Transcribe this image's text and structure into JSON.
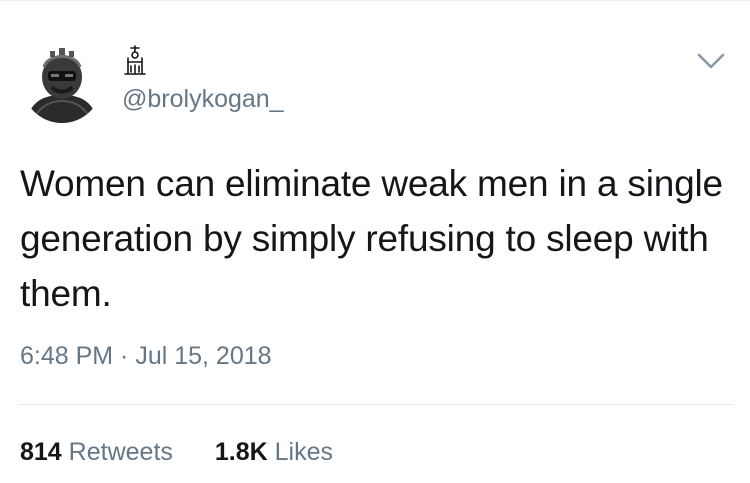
{
  "tweet": {
    "handle": "@brolykogan_",
    "text": "Women can eliminate weak men in a single generation by simply refusing to sleep with them.",
    "timestamp": "6:48 PM · Jul 15, 2018",
    "retweets": {
      "count": "814",
      "label": "Retweets"
    },
    "likes": {
      "count": "1.8K",
      "label": "Likes"
    }
  },
  "icons": {
    "menu": "chevron-down-icon",
    "display_name": "glyph-symbol-icon",
    "avatar": "helmet-avatar"
  },
  "colors": {
    "text": "#14171a",
    "secondary": "#657786",
    "divider": "#e1e8ed",
    "chevron": "#8899a6"
  }
}
